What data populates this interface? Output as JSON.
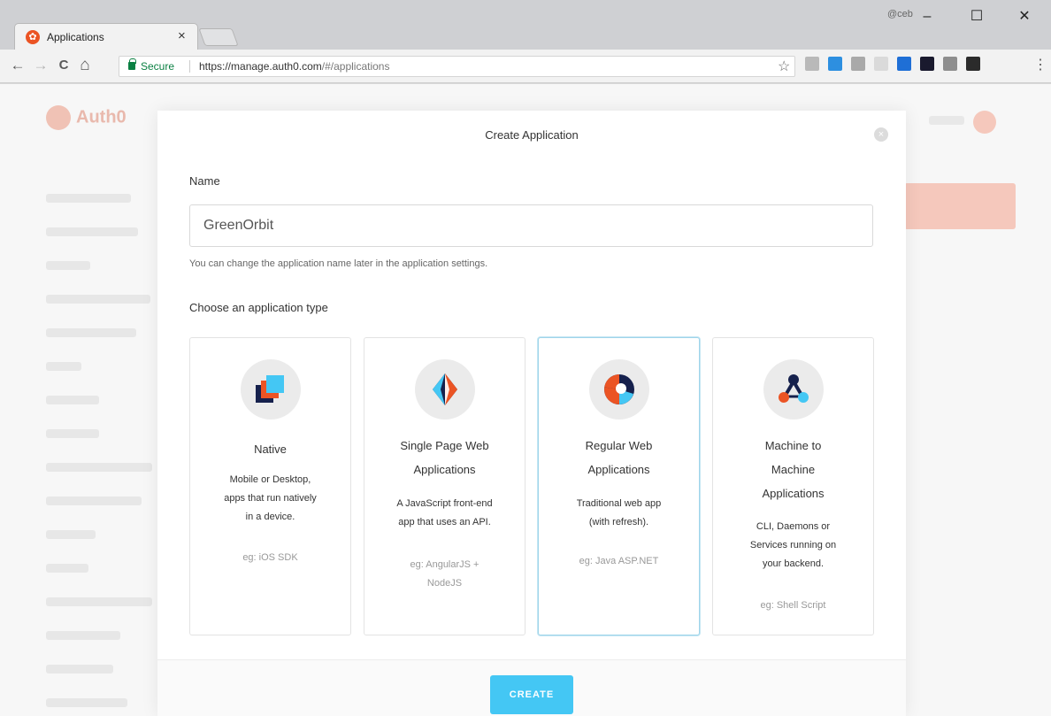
{
  "browser": {
    "tab_title": "Applications",
    "tab_close": "×",
    "window_user": "@ceb",
    "minimize": "–",
    "maximize": "☐",
    "close": "✕",
    "back": "←",
    "forward": "→",
    "reload": "C",
    "home": "⌂",
    "secure_label": "Secure",
    "url_host": "https://manage.auth0.com",
    "url_path": "/#/applications",
    "bookmark": "☆",
    "menu": "⋮",
    "extension_colors": [
      "#b9b9b9",
      "#2d8fe0",
      "#a9a9a9",
      "#dadada",
      "#1f6fd6",
      "#1a1a2e",
      "#8e8e8e",
      "#2b2b2b"
    ]
  },
  "background_page": {
    "logo_text": "Auth0"
  },
  "modal": {
    "title": "Create Application",
    "close_icon": "×",
    "name_label": "Name",
    "name_value": "GreenOrbit",
    "name_hint": "You can change the application name later in the application settings.",
    "type_label": "Choose an application type",
    "selected_type": "Regular Web Applications",
    "create_label": "CREATE",
    "accent_color": "#44c7f4",
    "types": [
      {
        "icon": "native-icon",
        "title_lines": [
          "Native"
        ],
        "desc_lines": [
          "Mobile or Desktop,",
          "apps that run natively",
          "in a device."
        ],
        "example_lines": [
          "eg: iOS SDK"
        ]
      },
      {
        "icon": "spa-icon",
        "title_lines": [
          "Single Page Web",
          "Applications"
        ],
        "desc_lines": [
          "A JavaScript front-end",
          "app that uses an API."
        ],
        "example_lines": [
          "eg: AngularJS +",
          "NodeJS"
        ]
      },
      {
        "icon": "regular-web-icon",
        "title_lines": [
          "Regular Web",
          "Applications"
        ],
        "desc_lines": [
          "Traditional web app",
          "(with refresh)."
        ],
        "example_lines": [
          "eg: Java ASP.NET"
        ]
      },
      {
        "icon": "machine-to-machine-icon",
        "title_lines": [
          "Machine to",
          "Machine",
          "Applications"
        ],
        "desc_lines": [
          "CLI, Daemons or",
          "Services running on",
          "your backend."
        ],
        "example_lines": [
          "eg: Shell Script"
        ]
      }
    ]
  }
}
